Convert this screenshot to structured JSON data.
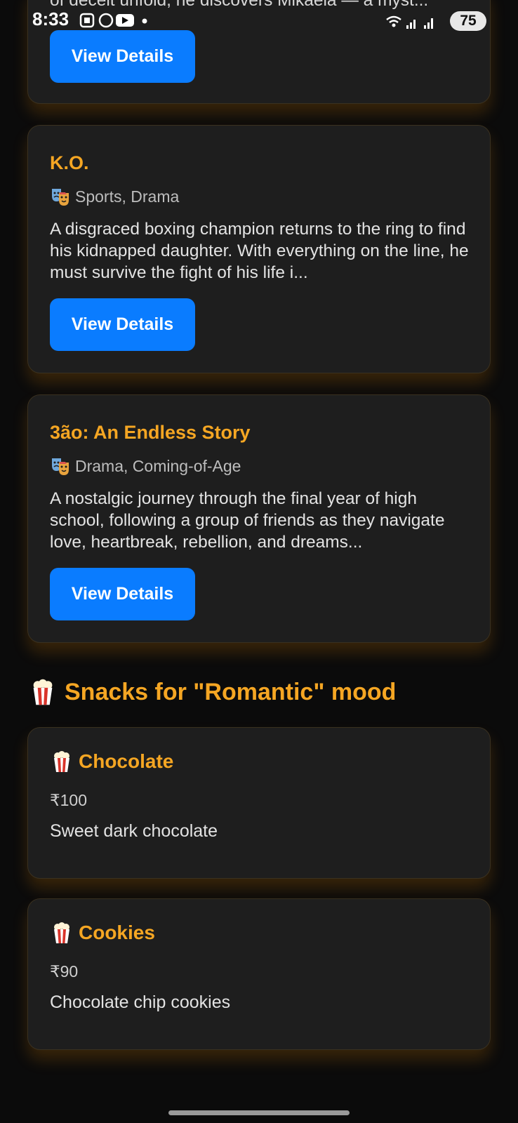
{
  "status_bar": {
    "time": "8:33",
    "battery": "75"
  },
  "top_card": {
    "partial_description": "of deceit unfold, he discovers Mikaela — a myst...",
    "button_label": "View Details"
  },
  "movies": [
    {
      "title": "K.O.",
      "genre": "Sports, Drama",
      "description": "A disgraced boxing champion returns to the ring to find his kidnapped daughter. With everything on the line, he must survive the fight of his life i...",
      "button_label": "View Details"
    },
    {
      "title": "3ão: An Endless Story",
      "genre": "Drama, Coming-of-Age",
      "description": "A nostalgic journey through the final year of high school, following a group of friends as they navigate love, heartbreak, rebellion, and dreams...",
      "button_label": "View Details"
    }
  ],
  "snacks_section": {
    "heading": "Snacks for \"Romantic\" mood",
    "items": [
      {
        "name": "Chocolate",
        "price": "₹100",
        "description": "Sweet dark chocolate"
      },
      {
        "name": "Cookies",
        "price": "₹90",
        "description": "Chocolate chip cookies"
      }
    ]
  },
  "colors": {
    "accent": "#f5a623",
    "button": "#0a7cff",
    "card": "#1e1e1e",
    "background": "#0b0b0b"
  }
}
